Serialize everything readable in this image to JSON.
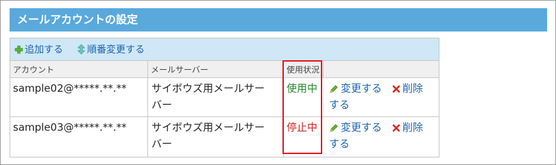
{
  "header": {
    "title": "メールアカウントの設定"
  },
  "toolbar": {
    "add_label": "追加する",
    "reorder_label": "順番変更する"
  },
  "columns": {
    "account": "アカウント",
    "server": "メールサーバー",
    "status": "使用状況"
  },
  "rows": [
    {
      "account": "sample02@*****.**.**",
      "server_line1": "サイボウズ用メールサー",
      "server_line2": "バー",
      "status": "使用中",
      "edit_label": "変更する",
      "delete_label": "削除",
      "delete_wrap": "する"
    },
    {
      "account": "sample03@*****.**.**",
      "server_line1": "サイボウズ用メールサー",
      "server_line2": "バー",
      "status": "停止中",
      "edit_label": "変更する",
      "delete_label": "削除",
      "delete_wrap": "する"
    }
  ],
  "colors": {
    "header_bg": "#5aa9dd",
    "toolbar_bg": "#cfe7f6",
    "link": "#1a63b0",
    "status_active": "#22882a",
    "status_stopped": "#d22020",
    "highlight_border": "#e8121d"
  },
  "icons": {
    "add": "plus-icon",
    "reorder": "up-down-arrows-icon",
    "edit": "pencil-icon",
    "delete": "x-icon"
  }
}
